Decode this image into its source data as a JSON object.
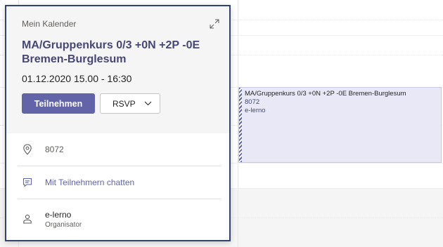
{
  "event": {
    "title": "MA/Gruppenkurs 0/3 +0N +2P -0E Bremen-Burglesum",
    "location": "8072",
    "organizer": "e-lerno"
  },
  "popup": {
    "calendar_name": "Mein Kalender",
    "title": "MA/Gruppenkurs 0/3 +0N +2P -0E Bremen-Burglesum",
    "datetime": "01.12.2020 15.00 - 16:30",
    "join_label": "Teilnehmen",
    "rsvp_label": "RSVP",
    "location": "8072",
    "chat_label": "Mit Teilnehmern chatten",
    "organizer_name": "e-lerno",
    "organizer_role": "Organisator"
  },
  "icons": {
    "expand": "expand-icon",
    "location": "location-pin-icon",
    "chat": "chat-icon",
    "person": "person-icon",
    "chevron": "chevron-down-icon"
  },
  "colors": {
    "accent": "#6264a7",
    "title": "#464775",
    "event_bg": "#e8e8f6",
    "card_border": "#30446f"
  }
}
